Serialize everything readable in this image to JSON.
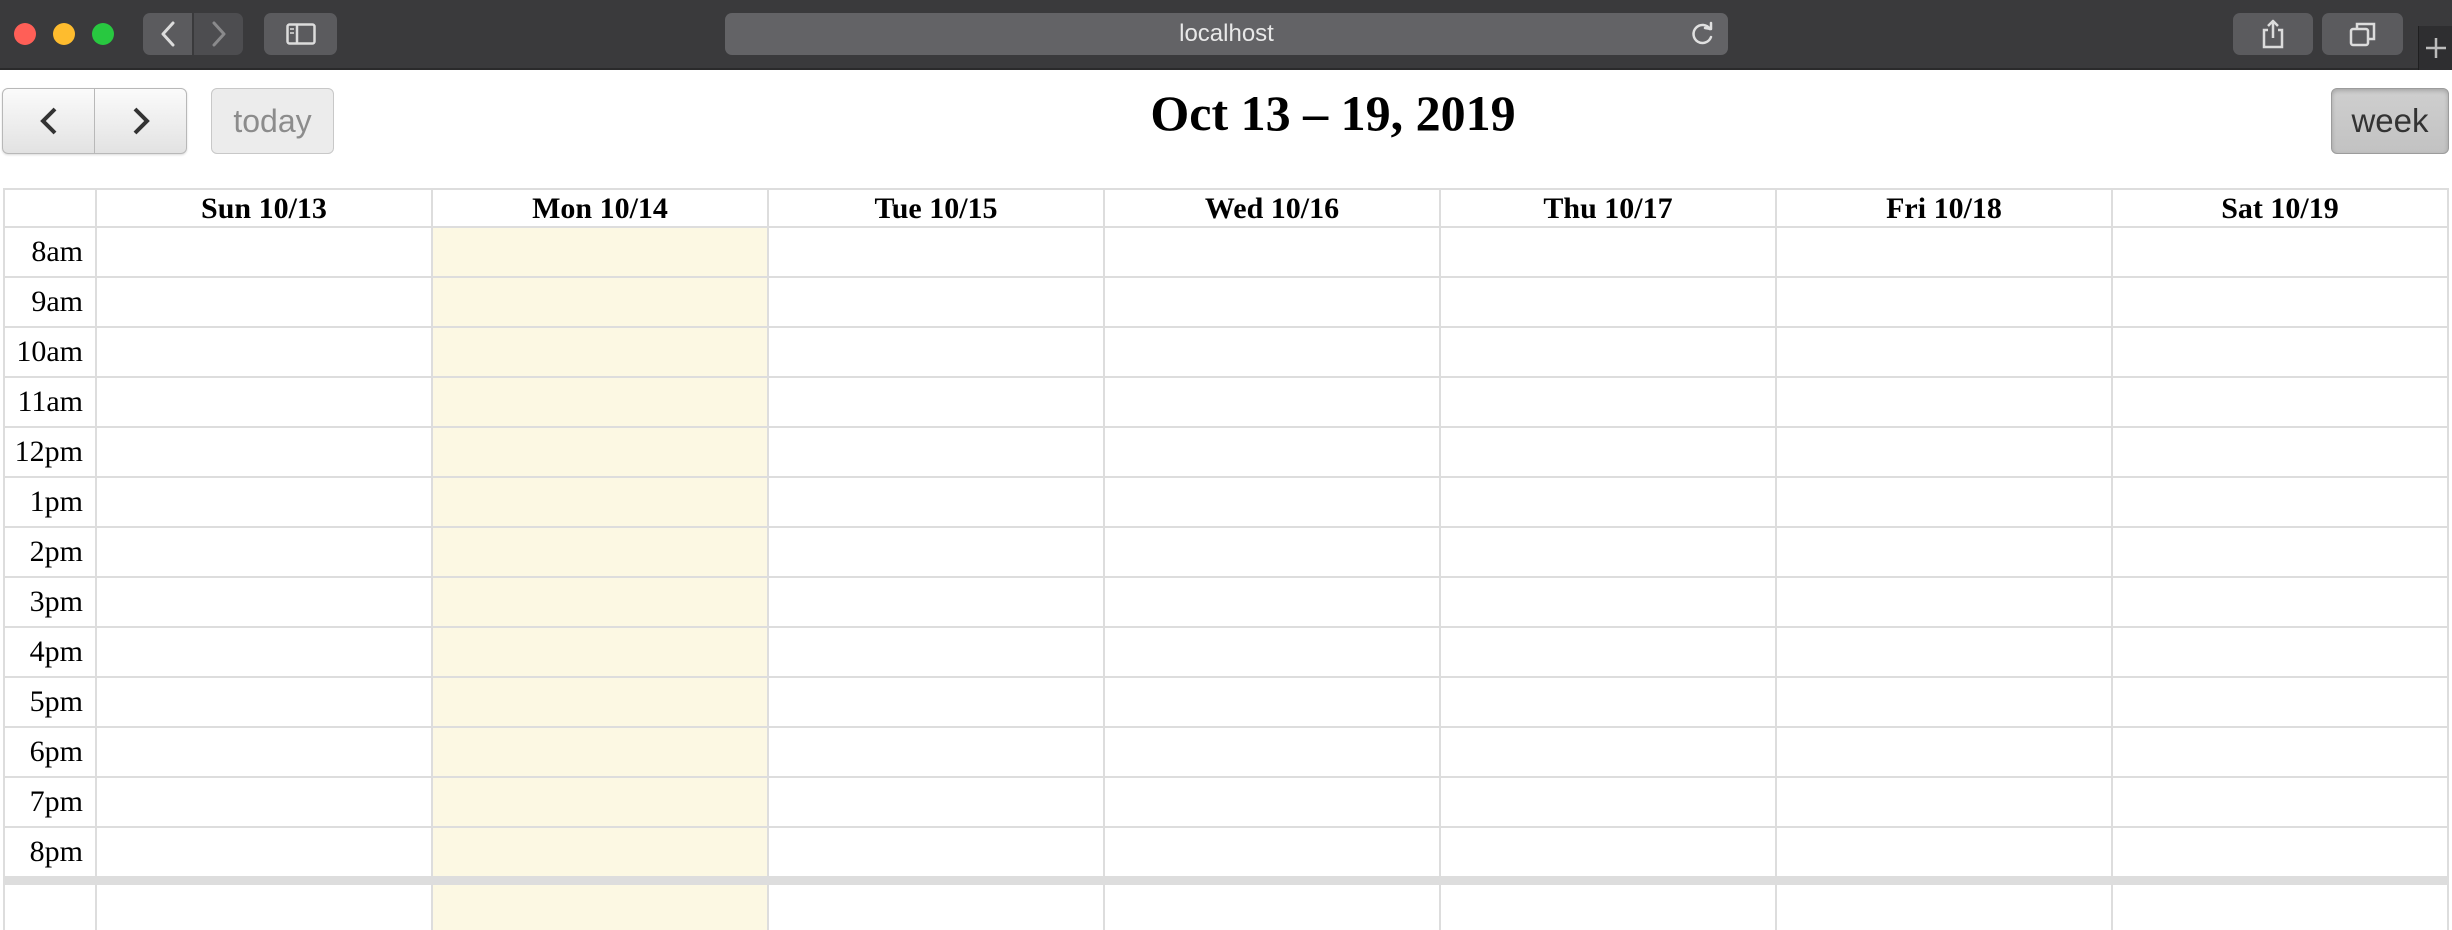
{
  "browser": {
    "url": "localhost"
  },
  "toolbar": {
    "today_label": "today",
    "title": "Oct 13 – 19, 2019",
    "week_label": "week"
  },
  "calendar": {
    "days": [
      "Sun 10/13",
      "Mon 10/14",
      "Tue 10/15",
      "Wed 10/16",
      "Thu 10/17",
      "Fri 10/18",
      "Sat 10/19"
    ],
    "highlighted_day": "Mon 10/14",
    "highlight_color": "#fcf8e3",
    "times": [
      "8am",
      "9am",
      "10am",
      "11am",
      "12pm",
      "1pm",
      "2pm",
      "3pm",
      "4pm",
      "5pm",
      "6pm",
      "7pm",
      "8pm"
    ]
  }
}
